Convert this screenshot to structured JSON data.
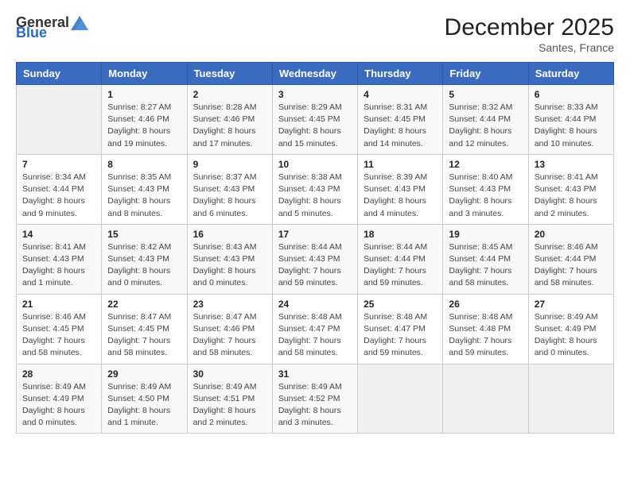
{
  "header": {
    "logo_general": "General",
    "logo_blue": "Blue",
    "month_title": "December 2025",
    "location": "Santes, France"
  },
  "days_of_week": [
    "Sunday",
    "Monday",
    "Tuesday",
    "Wednesday",
    "Thursday",
    "Friday",
    "Saturday"
  ],
  "weeks": [
    [
      {
        "day": "",
        "info": ""
      },
      {
        "day": "1",
        "info": "Sunrise: 8:27 AM\nSunset: 4:46 PM\nDaylight: 8 hours\nand 19 minutes."
      },
      {
        "day": "2",
        "info": "Sunrise: 8:28 AM\nSunset: 4:46 PM\nDaylight: 8 hours\nand 17 minutes."
      },
      {
        "day": "3",
        "info": "Sunrise: 8:29 AM\nSunset: 4:45 PM\nDaylight: 8 hours\nand 15 minutes."
      },
      {
        "day": "4",
        "info": "Sunrise: 8:31 AM\nSunset: 4:45 PM\nDaylight: 8 hours\nand 14 minutes."
      },
      {
        "day": "5",
        "info": "Sunrise: 8:32 AM\nSunset: 4:44 PM\nDaylight: 8 hours\nand 12 minutes."
      },
      {
        "day": "6",
        "info": "Sunrise: 8:33 AM\nSunset: 4:44 PM\nDaylight: 8 hours\nand 10 minutes."
      }
    ],
    [
      {
        "day": "7",
        "info": "Sunrise: 8:34 AM\nSunset: 4:44 PM\nDaylight: 8 hours\nand 9 minutes."
      },
      {
        "day": "8",
        "info": "Sunrise: 8:35 AM\nSunset: 4:43 PM\nDaylight: 8 hours\nand 8 minutes."
      },
      {
        "day": "9",
        "info": "Sunrise: 8:37 AM\nSunset: 4:43 PM\nDaylight: 8 hours\nand 6 minutes."
      },
      {
        "day": "10",
        "info": "Sunrise: 8:38 AM\nSunset: 4:43 PM\nDaylight: 8 hours\nand 5 minutes."
      },
      {
        "day": "11",
        "info": "Sunrise: 8:39 AM\nSunset: 4:43 PM\nDaylight: 8 hours\nand 4 minutes."
      },
      {
        "day": "12",
        "info": "Sunrise: 8:40 AM\nSunset: 4:43 PM\nDaylight: 8 hours\nand 3 minutes."
      },
      {
        "day": "13",
        "info": "Sunrise: 8:41 AM\nSunset: 4:43 PM\nDaylight: 8 hours\nand 2 minutes."
      }
    ],
    [
      {
        "day": "14",
        "info": "Sunrise: 8:41 AM\nSunset: 4:43 PM\nDaylight: 8 hours\nand 1 minute."
      },
      {
        "day": "15",
        "info": "Sunrise: 8:42 AM\nSunset: 4:43 PM\nDaylight: 8 hours\nand 0 minutes."
      },
      {
        "day": "16",
        "info": "Sunrise: 8:43 AM\nSunset: 4:43 PM\nDaylight: 8 hours\nand 0 minutes."
      },
      {
        "day": "17",
        "info": "Sunrise: 8:44 AM\nSunset: 4:43 PM\nDaylight: 7 hours\nand 59 minutes."
      },
      {
        "day": "18",
        "info": "Sunrise: 8:44 AM\nSunset: 4:44 PM\nDaylight: 7 hours\nand 59 minutes."
      },
      {
        "day": "19",
        "info": "Sunrise: 8:45 AM\nSunset: 4:44 PM\nDaylight: 7 hours\nand 58 minutes."
      },
      {
        "day": "20",
        "info": "Sunrise: 8:46 AM\nSunset: 4:44 PM\nDaylight: 7 hours\nand 58 minutes."
      }
    ],
    [
      {
        "day": "21",
        "info": "Sunrise: 8:46 AM\nSunset: 4:45 PM\nDaylight: 7 hours\nand 58 minutes."
      },
      {
        "day": "22",
        "info": "Sunrise: 8:47 AM\nSunset: 4:45 PM\nDaylight: 7 hours\nand 58 minutes."
      },
      {
        "day": "23",
        "info": "Sunrise: 8:47 AM\nSunset: 4:46 PM\nDaylight: 7 hours\nand 58 minutes."
      },
      {
        "day": "24",
        "info": "Sunrise: 8:48 AM\nSunset: 4:47 PM\nDaylight: 7 hours\nand 58 minutes."
      },
      {
        "day": "25",
        "info": "Sunrise: 8:48 AM\nSunset: 4:47 PM\nDaylight: 7 hours\nand 59 minutes."
      },
      {
        "day": "26",
        "info": "Sunrise: 8:48 AM\nSunset: 4:48 PM\nDaylight: 7 hours\nand 59 minutes."
      },
      {
        "day": "27",
        "info": "Sunrise: 8:49 AM\nSunset: 4:49 PM\nDaylight: 8 hours\nand 0 minutes."
      }
    ],
    [
      {
        "day": "28",
        "info": "Sunrise: 8:49 AM\nSunset: 4:49 PM\nDaylight: 8 hours\nand 0 minutes."
      },
      {
        "day": "29",
        "info": "Sunrise: 8:49 AM\nSunset: 4:50 PM\nDaylight: 8 hours\nand 1 minute."
      },
      {
        "day": "30",
        "info": "Sunrise: 8:49 AM\nSunset: 4:51 PM\nDaylight: 8 hours\nand 2 minutes."
      },
      {
        "day": "31",
        "info": "Sunrise: 8:49 AM\nSunset: 4:52 PM\nDaylight: 8 hours\nand 3 minutes."
      },
      {
        "day": "",
        "info": ""
      },
      {
        "day": "",
        "info": ""
      },
      {
        "day": "",
        "info": ""
      }
    ]
  ]
}
